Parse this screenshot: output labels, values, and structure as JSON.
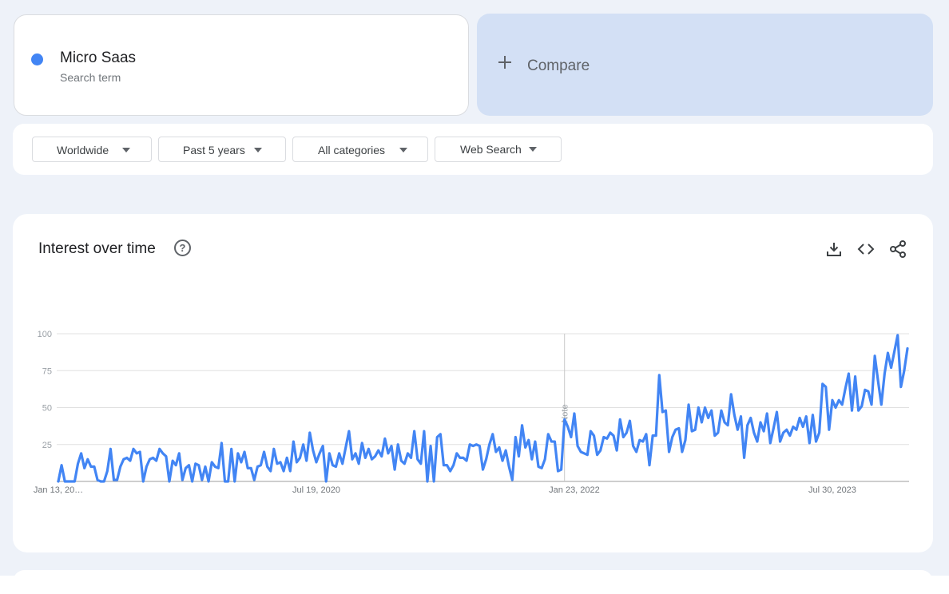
{
  "search_term": {
    "name": "Micro Saas",
    "type": "Search term",
    "color": "#4285f4"
  },
  "compare": {
    "label": "Compare"
  },
  "filters": [
    {
      "label": "Worldwide"
    },
    {
      "label": "Past 5 years"
    },
    {
      "label": "All categories"
    },
    {
      "label": "Web Search"
    }
  ],
  "interest": {
    "title": "Interest over time",
    "help_icon": "help-circle-icon",
    "tools": [
      "download-icon",
      "embed-code-icon",
      "share-icon"
    ]
  },
  "chart_data": {
    "type": "line",
    "ylim": [
      0,
      100
    ],
    "yticks": [
      25,
      50,
      75,
      100
    ],
    "grid": true,
    "x_tick_labels": [
      "Jan 13, 20…",
      "Jul 19, 2020",
      "Jan 23, 2022",
      "Jul 30, 2023"
    ],
    "x_tick_index": [
      0,
      79,
      158,
      237
    ],
    "note": {
      "label": "Note",
      "index": 155
    },
    "series": [
      {
        "color": "#4285f4",
        "values": [
          0,
          11,
          0,
          0,
          0,
          0,
          12,
          19,
          9,
          15,
          10,
          10,
          1,
          0,
          0,
          7,
          22,
          1,
          1,
          10,
          15,
          16,
          14,
          22,
          19,
          20,
          0,
          10,
          15,
          16,
          14,
          22,
          19,
          17,
          0,
          14,
          11,
          19,
          1,
          9,
          11,
          0,
          12,
          11,
          1,
          10,
          0,
          13,
          10,
          9,
          26,
          0,
          0,
          22,
          0,
          19,
          13,
          20,
          9,
          9,
          1,
          10,
          11,
          20,
          10,
          7,
          22,
          12,
          13,
          7,
          16,
          7,
          27,
          13,
          16,
          25,
          14,
          33,
          21,
          13,
          19,
          24,
          0,
          19,
          11,
          10,
          19,
          12,
          23,
          34,
          15,
          19,
          12,
          26,
          16,
          22,
          15,
          17,
          21,
          17,
          29,
          19,
          24,
          8,
          25,
          14,
          12,
          19,
          16,
          34,
          15,
          12,
          34,
          0,
          24,
          0,
          30,
          32,
          11,
          11,
          7,
          11,
          19,
          16,
          16,
          14,
          25,
          24,
          25,
          24,
          8,
          15,
          25,
          32,
          20,
          23,
          14,
          21,
          10,
          1,
          30,
          17,
          38,
          23,
          28,
          15,
          27,
          10,
          9,
          15,
          32,
          27,
          27,
          7,
          8,
          42,
          37,
          30,
          46,
          24,
          20,
          19,
          18,
          34,
          31,
          18,
          21,
          30,
          29,
          33,
          31,
          21,
          42,
          30,
          33,
          41,
          24,
          20,
          28,
          27,
          32,
          11,
          31,
          31,
          72,
          47,
          48,
          20,
          30,
          35,
          36,
          20,
          28,
          52,
          34,
          35,
          50,
          40,
          50,
          43,
          48,
          31,
          33,
          48,
          40,
          38,
          59,
          45,
          35,
          44,
          16,
          38,
          43,
          33,
          27,
          40,
          34,
          46,
          26,
          36,
          47,
          27,
          33,
          35,
          31,
          37,
          35,
          43,
          37,
          44,
          26,
          45,
          27,
          33,
          66,
          64,
          35,
          55,
          50,
          55,
          52,
          63,
          73,
          48,
          71,
          48,
          51,
          62,
          61,
          52,
          85,
          68,
          52,
          73,
          87,
          77,
          88,
          99,
          64,
          75,
          90
        ]
      }
    ]
  }
}
